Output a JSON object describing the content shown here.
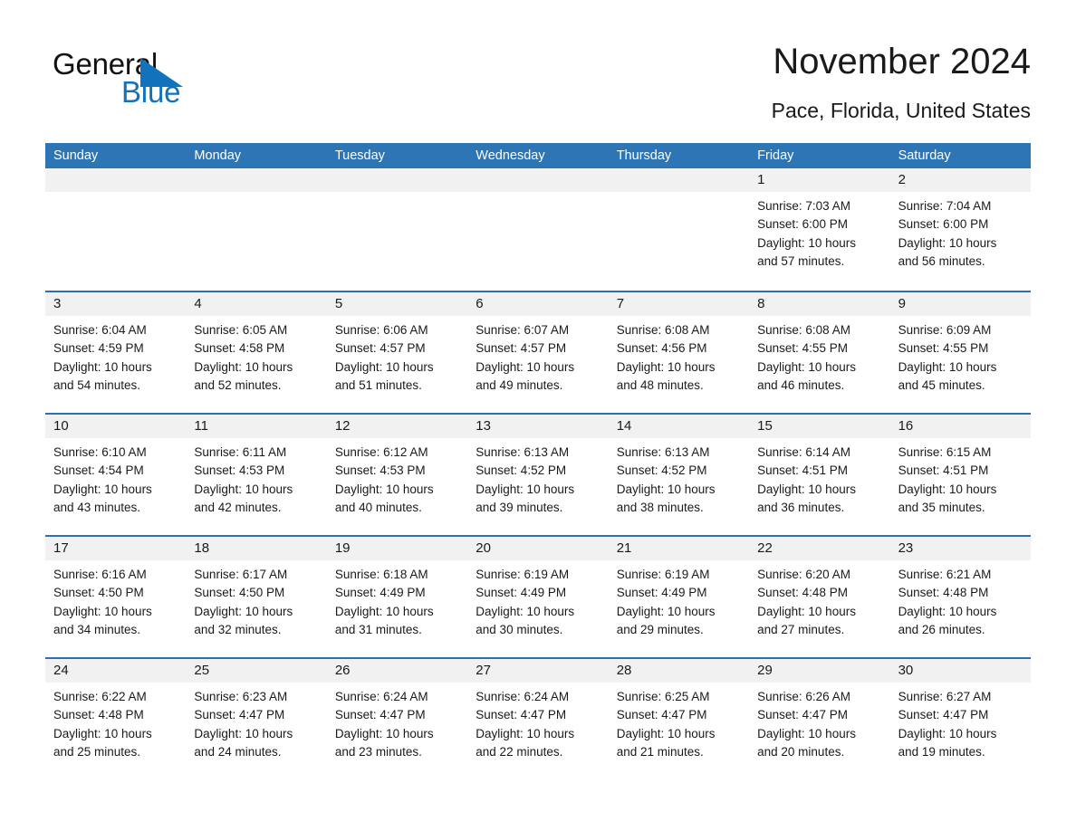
{
  "brand": {
    "name_part1": "General",
    "name_part2": "Blue",
    "triangle_icon": "triangle-icon",
    "color_blue": "#1272bb"
  },
  "header": {
    "title": "November 2024",
    "location": "Pace, Florida, United States"
  },
  "theme": {
    "header_bar": "#2e75b6",
    "row_divider": "#2e6faf",
    "daynum_band": "#f1f1f1",
    "text": "#1a1a1a"
  },
  "weekdays": [
    "Sunday",
    "Monday",
    "Tuesday",
    "Wednesday",
    "Thursday",
    "Friday",
    "Saturday"
  ],
  "labels": {
    "sunrise_prefix": "Sunrise: ",
    "sunset_prefix": "Sunset: ",
    "daylight_prefix": "Daylight: "
  },
  "weeks": [
    [
      {
        "day": "",
        "l1": "",
        "l2": "",
        "l3": "",
        "l4": ""
      },
      {
        "day": "",
        "l1": "",
        "l2": "",
        "l3": "",
        "l4": ""
      },
      {
        "day": "",
        "l1": "",
        "l2": "",
        "l3": "",
        "l4": ""
      },
      {
        "day": "",
        "l1": "",
        "l2": "",
        "l3": "",
        "l4": ""
      },
      {
        "day": "",
        "l1": "",
        "l2": "",
        "l3": "",
        "l4": ""
      },
      {
        "day": "1",
        "l1": "Sunrise: 7:03 AM",
        "l2": "Sunset: 6:00 PM",
        "l3": "Daylight: 10 hours",
        "l4": "and 57 minutes."
      },
      {
        "day": "2",
        "l1": "Sunrise: 7:04 AM",
        "l2": "Sunset: 6:00 PM",
        "l3": "Daylight: 10 hours",
        "l4": "and 56 minutes."
      }
    ],
    [
      {
        "day": "3",
        "l1": "Sunrise: 6:04 AM",
        "l2": "Sunset: 4:59 PM",
        "l3": "Daylight: 10 hours",
        "l4": "and 54 minutes."
      },
      {
        "day": "4",
        "l1": "Sunrise: 6:05 AM",
        "l2": "Sunset: 4:58 PM",
        "l3": "Daylight: 10 hours",
        "l4": "and 52 minutes."
      },
      {
        "day": "5",
        "l1": "Sunrise: 6:06 AM",
        "l2": "Sunset: 4:57 PM",
        "l3": "Daylight: 10 hours",
        "l4": "and 51 minutes."
      },
      {
        "day": "6",
        "l1": "Sunrise: 6:07 AM",
        "l2": "Sunset: 4:57 PM",
        "l3": "Daylight: 10 hours",
        "l4": "and 49 minutes."
      },
      {
        "day": "7",
        "l1": "Sunrise: 6:08 AM",
        "l2": "Sunset: 4:56 PM",
        "l3": "Daylight: 10 hours",
        "l4": "and 48 minutes."
      },
      {
        "day": "8",
        "l1": "Sunrise: 6:08 AM",
        "l2": "Sunset: 4:55 PM",
        "l3": "Daylight: 10 hours",
        "l4": "and 46 minutes."
      },
      {
        "day": "9",
        "l1": "Sunrise: 6:09 AM",
        "l2": "Sunset: 4:55 PM",
        "l3": "Daylight: 10 hours",
        "l4": "and 45 minutes."
      }
    ],
    [
      {
        "day": "10",
        "l1": "Sunrise: 6:10 AM",
        "l2": "Sunset: 4:54 PM",
        "l3": "Daylight: 10 hours",
        "l4": "and 43 minutes."
      },
      {
        "day": "11",
        "l1": "Sunrise: 6:11 AM",
        "l2": "Sunset: 4:53 PM",
        "l3": "Daylight: 10 hours",
        "l4": "and 42 minutes."
      },
      {
        "day": "12",
        "l1": "Sunrise: 6:12 AM",
        "l2": "Sunset: 4:53 PM",
        "l3": "Daylight: 10 hours",
        "l4": "and 40 minutes."
      },
      {
        "day": "13",
        "l1": "Sunrise: 6:13 AM",
        "l2": "Sunset: 4:52 PM",
        "l3": "Daylight: 10 hours",
        "l4": "and 39 minutes."
      },
      {
        "day": "14",
        "l1": "Sunrise: 6:13 AM",
        "l2": "Sunset: 4:52 PM",
        "l3": "Daylight: 10 hours",
        "l4": "and 38 minutes."
      },
      {
        "day": "15",
        "l1": "Sunrise: 6:14 AM",
        "l2": "Sunset: 4:51 PM",
        "l3": "Daylight: 10 hours",
        "l4": "and 36 minutes."
      },
      {
        "day": "16",
        "l1": "Sunrise: 6:15 AM",
        "l2": "Sunset: 4:51 PM",
        "l3": "Daylight: 10 hours",
        "l4": "and 35 minutes."
      }
    ],
    [
      {
        "day": "17",
        "l1": "Sunrise: 6:16 AM",
        "l2": "Sunset: 4:50 PM",
        "l3": "Daylight: 10 hours",
        "l4": "and 34 minutes."
      },
      {
        "day": "18",
        "l1": "Sunrise: 6:17 AM",
        "l2": "Sunset: 4:50 PM",
        "l3": "Daylight: 10 hours",
        "l4": "and 32 minutes."
      },
      {
        "day": "19",
        "l1": "Sunrise: 6:18 AM",
        "l2": "Sunset: 4:49 PM",
        "l3": "Daylight: 10 hours",
        "l4": "and 31 minutes."
      },
      {
        "day": "20",
        "l1": "Sunrise: 6:19 AM",
        "l2": "Sunset: 4:49 PM",
        "l3": "Daylight: 10 hours",
        "l4": "and 30 minutes."
      },
      {
        "day": "21",
        "l1": "Sunrise: 6:19 AM",
        "l2": "Sunset: 4:49 PM",
        "l3": "Daylight: 10 hours",
        "l4": "and 29 minutes."
      },
      {
        "day": "22",
        "l1": "Sunrise: 6:20 AM",
        "l2": "Sunset: 4:48 PM",
        "l3": "Daylight: 10 hours",
        "l4": "and 27 minutes."
      },
      {
        "day": "23",
        "l1": "Sunrise: 6:21 AM",
        "l2": "Sunset: 4:48 PM",
        "l3": "Daylight: 10 hours",
        "l4": "and 26 minutes."
      }
    ],
    [
      {
        "day": "24",
        "l1": "Sunrise: 6:22 AM",
        "l2": "Sunset: 4:48 PM",
        "l3": "Daylight: 10 hours",
        "l4": "and 25 minutes."
      },
      {
        "day": "25",
        "l1": "Sunrise: 6:23 AM",
        "l2": "Sunset: 4:47 PM",
        "l3": "Daylight: 10 hours",
        "l4": "and 24 minutes."
      },
      {
        "day": "26",
        "l1": "Sunrise: 6:24 AM",
        "l2": "Sunset: 4:47 PM",
        "l3": "Daylight: 10 hours",
        "l4": "and 23 minutes."
      },
      {
        "day": "27",
        "l1": "Sunrise: 6:24 AM",
        "l2": "Sunset: 4:47 PM",
        "l3": "Daylight: 10 hours",
        "l4": "and 22 minutes."
      },
      {
        "day": "28",
        "l1": "Sunrise: 6:25 AM",
        "l2": "Sunset: 4:47 PM",
        "l3": "Daylight: 10 hours",
        "l4": "and 21 minutes."
      },
      {
        "day": "29",
        "l1": "Sunrise: 6:26 AM",
        "l2": "Sunset: 4:47 PM",
        "l3": "Daylight: 10 hours",
        "l4": "and 20 minutes."
      },
      {
        "day": "30",
        "l1": "Sunrise: 6:27 AM",
        "l2": "Sunset: 4:47 PM",
        "l3": "Daylight: 10 hours",
        "l4": "and 19 minutes."
      }
    ]
  ]
}
